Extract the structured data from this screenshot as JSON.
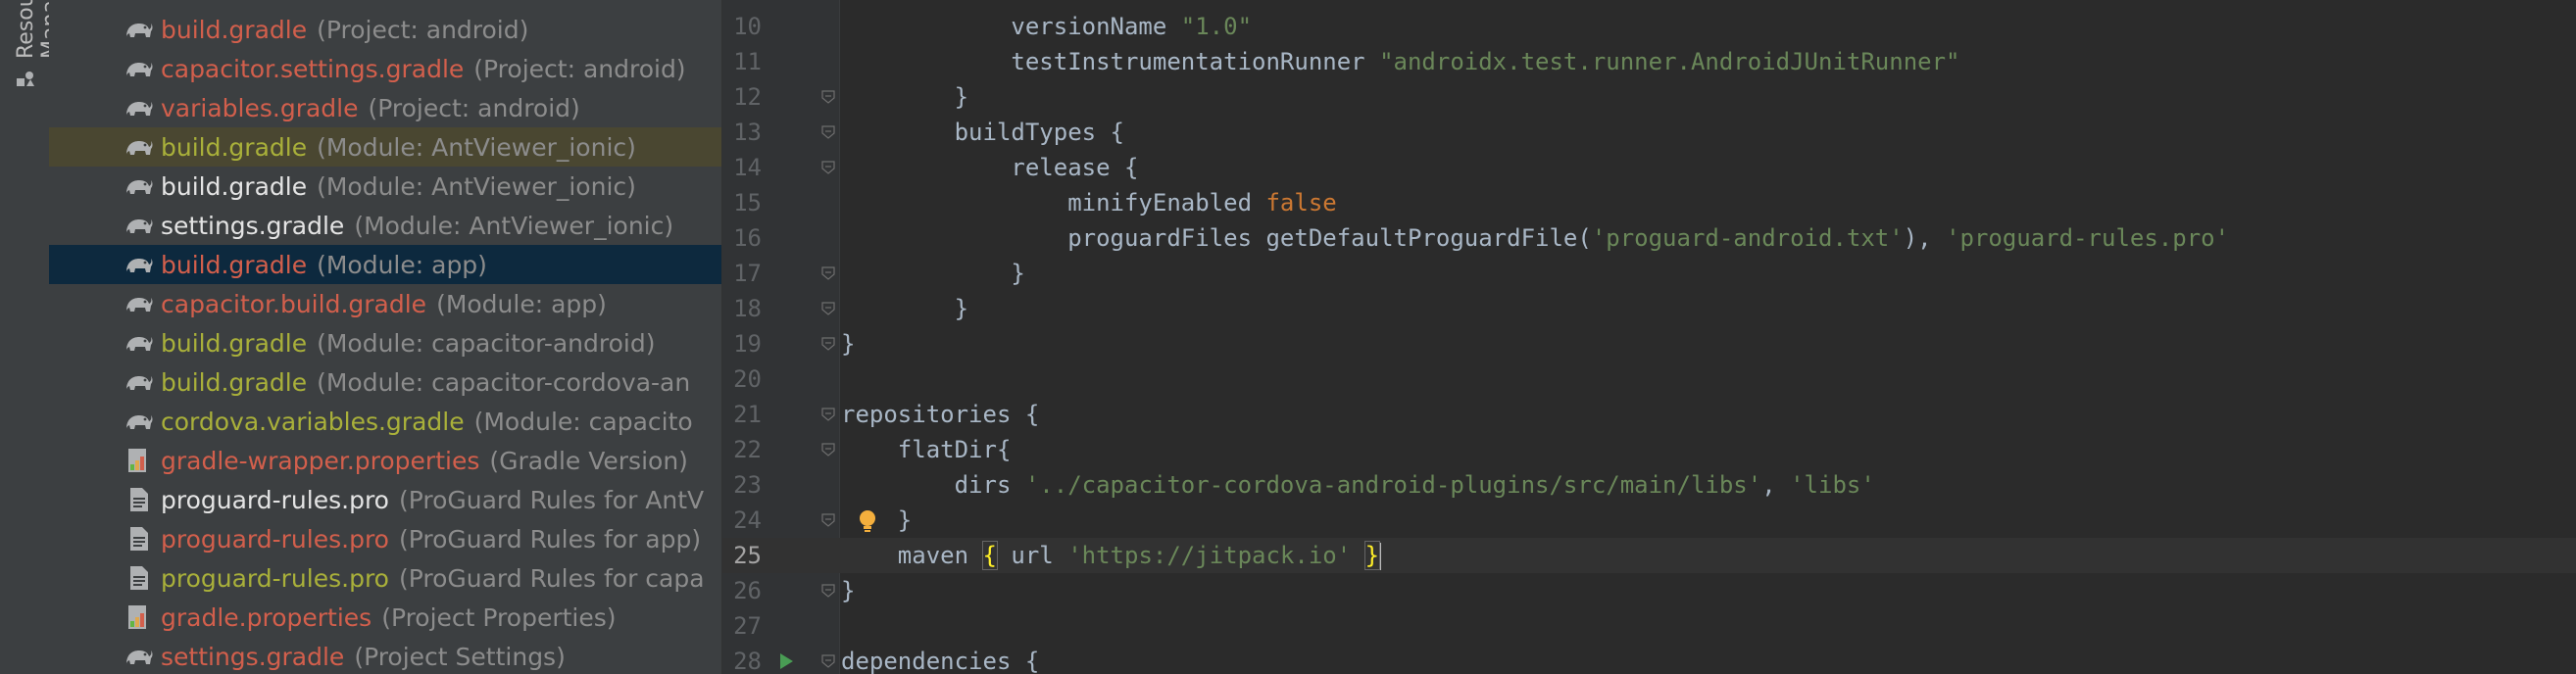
{
  "toolstrip": {
    "resource_tab_label": "Resource Manager"
  },
  "tree": {
    "rows": [
      {
        "name": "build.gradle",
        "desc": "(Project: android)",
        "color": "red",
        "icon": "gradle-elephant-icon",
        "state": ""
      },
      {
        "name": "capacitor.settings.gradle",
        "desc": "(Project: android)",
        "color": "red",
        "icon": "gradle-elephant-icon",
        "state": ""
      },
      {
        "name": "variables.gradle",
        "desc": "(Project: android)",
        "color": "red",
        "icon": "gradle-elephant-icon",
        "state": ""
      },
      {
        "name": "build.gradle",
        "desc": "(Module: AntViewer_ionic)",
        "color": "olive",
        "icon": "gradle-elephant-icon",
        "state": "highlight"
      },
      {
        "name": "build.gradle",
        "desc": "(Module: AntViewer_ionic)",
        "color": "white",
        "icon": "gradle-elephant-icon",
        "state": ""
      },
      {
        "name": "settings.gradle",
        "desc": "(Module: AntViewer_ionic)",
        "color": "white",
        "icon": "gradle-elephant-icon",
        "state": ""
      },
      {
        "name": "build.gradle",
        "desc": "(Module: app)",
        "color": "red",
        "icon": "gradle-elephant-icon",
        "state": "selected"
      },
      {
        "name": "capacitor.build.gradle",
        "desc": "(Module: app)",
        "color": "red",
        "icon": "gradle-elephant-icon",
        "state": ""
      },
      {
        "name": "build.gradle",
        "desc": "(Module: capacitor-android)",
        "color": "olive",
        "icon": "gradle-elephant-icon",
        "state": ""
      },
      {
        "name": "build.gradle",
        "desc": "(Module: capacitor-cordova-an",
        "color": "olive",
        "icon": "gradle-elephant-icon",
        "state": ""
      },
      {
        "name": "cordova.variables.gradle",
        "desc": "(Module: capacito",
        "color": "olive",
        "icon": "gradle-elephant-icon",
        "state": ""
      },
      {
        "name": "gradle-wrapper.properties",
        "desc": "(Gradle Version)",
        "color": "red",
        "icon": "properties-file-icon",
        "state": ""
      },
      {
        "name": "proguard-rules.pro",
        "desc": "(ProGuard Rules for AntV",
        "color": "white",
        "icon": "text-file-icon",
        "state": ""
      },
      {
        "name": "proguard-rules.pro",
        "desc": "(ProGuard Rules for app)",
        "color": "red",
        "icon": "text-file-icon",
        "state": ""
      },
      {
        "name": "proguard-rules.pro",
        "desc": "(ProGuard Rules for capa",
        "color": "olive",
        "icon": "text-file-icon",
        "state": ""
      },
      {
        "name": "gradle.properties",
        "desc": "(Project Properties)",
        "color": "red",
        "icon": "properties-file-icon",
        "state": ""
      },
      {
        "name": "settings.gradle",
        "desc": "(Project Settings)",
        "color": "red",
        "icon": "gradle-elephant-icon",
        "state": ""
      }
    ]
  },
  "editor": {
    "current_line": "25",
    "lines": [
      {
        "n": "10",
        "tokens": [
          [
            "",
            "            versionName "
          ],
          [
            "str",
            "\"1.0\""
          ]
        ]
      },
      {
        "n": "11",
        "tokens": [
          [
            "",
            "            testInstrumentationRunner "
          ],
          [
            "str",
            "\"androidx.test.runner.AndroidJUnitRunner\""
          ]
        ]
      },
      {
        "n": "12",
        "tokens": [
          [
            "",
            "        }"
          ]
        ]
      },
      {
        "n": "13",
        "tokens": [
          [
            "",
            "        buildTypes {"
          ]
        ]
      },
      {
        "n": "14",
        "tokens": [
          [
            "",
            "            release {"
          ]
        ]
      },
      {
        "n": "15",
        "tokens": [
          [
            "",
            "                minifyEnabled "
          ],
          [
            "kw",
            "false"
          ]
        ]
      },
      {
        "n": "16",
        "tokens": [
          [
            "",
            "                proguardFiles getDefaultProguardFile("
          ],
          [
            "str",
            "'proguard-android.txt'"
          ],
          [
            "",
            "), "
          ],
          [
            "str",
            "'proguard-rules.pro'"
          ]
        ]
      },
      {
        "n": "17",
        "tokens": [
          [
            "",
            "            }"
          ]
        ]
      },
      {
        "n": "18",
        "tokens": [
          [
            "",
            "        }"
          ]
        ]
      },
      {
        "n": "19",
        "tokens": [
          [
            "",
            "}"
          ]
        ]
      },
      {
        "n": "20",
        "tokens": [
          [
            "",
            ""
          ]
        ]
      },
      {
        "n": "21",
        "tokens": [
          [
            "",
            "repositories {"
          ]
        ]
      },
      {
        "n": "22",
        "tokens": [
          [
            "",
            "    flatDir{"
          ]
        ]
      },
      {
        "n": "23",
        "tokens": [
          [
            "",
            "        dirs "
          ],
          [
            "str",
            "'../capacitor-cordova-android-plugins/src/main/libs'"
          ],
          [
            "",
            ", "
          ],
          [
            "str",
            "'libs'"
          ]
        ]
      },
      {
        "n": "24",
        "tokens": [
          [
            "",
            "    }"
          ]
        ]
      },
      {
        "n": "25",
        "tokens": [
          [
            "",
            "    maven "
          ],
          [
            "match",
            "{"
          ],
          [
            "",
            " url "
          ],
          [
            "str",
            "'https://jitpack.io'"
          ],
          [
            "",
            " "
          ],
          [
            "match",
            "}"
          ]
        ]
      },
      {
        "n": "26",
        "tokens": [
          [
            "",
            "}"
          ]
        ]
      },
      {
        "n": "27",
        "tokens": [
          [
            "",
            ""
          ]
        ]
      },
      {
        "n": "28",
        "tokens": [
          [
            "",
            "dependencies {"
          ]
        ]
      }
    ],
    "fold_lines": [
      "12",
      "13",
      "14",
      "17",
      "18",
      "19",
      "21",
      "22",
      "24",
      "26",
      "28"
    ],
    "bulb_line": "24",
    "run_line": "28"
  },
  "colors": {
    "red": "#d25f4c",
    "olive": "#a9b03a",
    "white": "#e4e4e4",
    "string": "#6a8759",
    "keyword": "#cc7832",
    "default_code": "#a9b7c6"
  }
}
